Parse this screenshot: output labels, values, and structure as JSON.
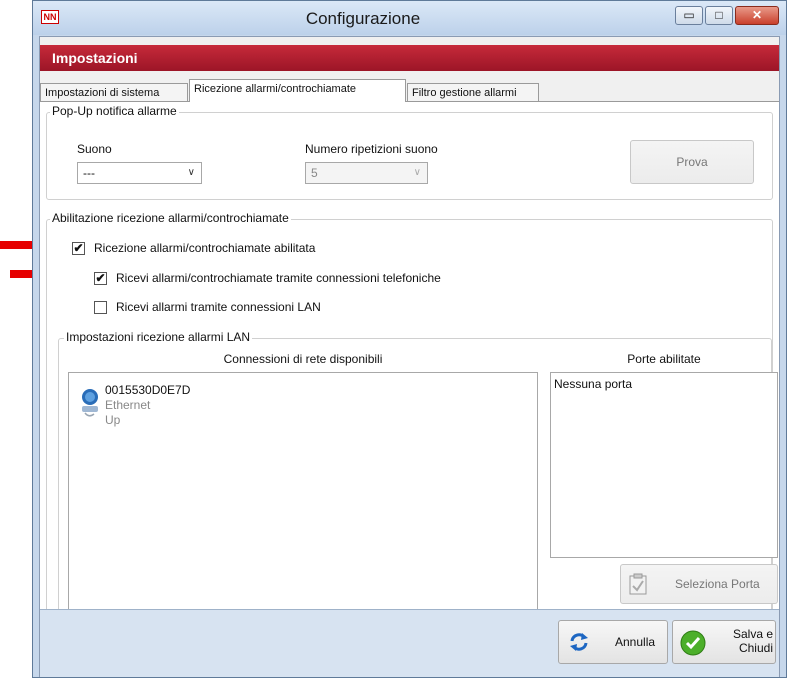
{
  "window": {
    "title": "Configurazione",
    "app_icon_text": "NN",
    "minimize_glyph": "▭",
    "maximize_glyph": "□",
    "close_glyph": "✕"
  },
  "header": {
    "title": "Impostazioni",
    "color": "#b01e30"
  },
  "tabs": [
    {
      "label": "Impostazioni di sistema",
      "active": false
    },
    {
      "label": "Ricezione allarmi/controchiamate",
      "active": true
    },
    {
      "label": "Filtro gestione allarmi",
      "active": false
    }
  ],
  "popup_group": {
    "title": "Pop-Up notifica allarme",
    "sound_label": "Suono",
    "sound_value": "---",
    "repeat_label": "Numero ripetizioni suono",
    "repeat_value": "5",
    "test_button": "Prova"
  },
  "enable_group": {
    "title": "Abilitazione ricezione allarmi/controchiamate",
    "checkboxes": [
      {
        "label": "Ricezione allarmi/controchiamate abilitata",
        "checked": true
      },
      {
        "label": "Ricevi allarmi/controchiamate tramite connessioni telefoniche",
        "checked": true
      },
      {
        "label": "Ricevi allarmi tramite connessioni LAN",
        "checked": false
      }
    ]
  },
  "lan_group": {
    "title": "Impostazioni ricezione allarmi LAN",
    "connections_header": "Connessioni di rete disponibili",
    "ports_header": "Porte abilitate",
    "connection": {
      "name": "0015530D0E7D",
      "type": "Ethernet",
      "status": "Up",
      "icon": "network-adapter-icon"
    },
    "ports_empty": "Nessuna porta",
    "select_port_button": "Seleziona Porta"
  },
  "footer": {
    "cancel_button": "Annulla",
    "save_button_line1": "Salva e",
    "save_button_line2": "Chiudi"
  },
  "annotation_color": "#e60000"
}
